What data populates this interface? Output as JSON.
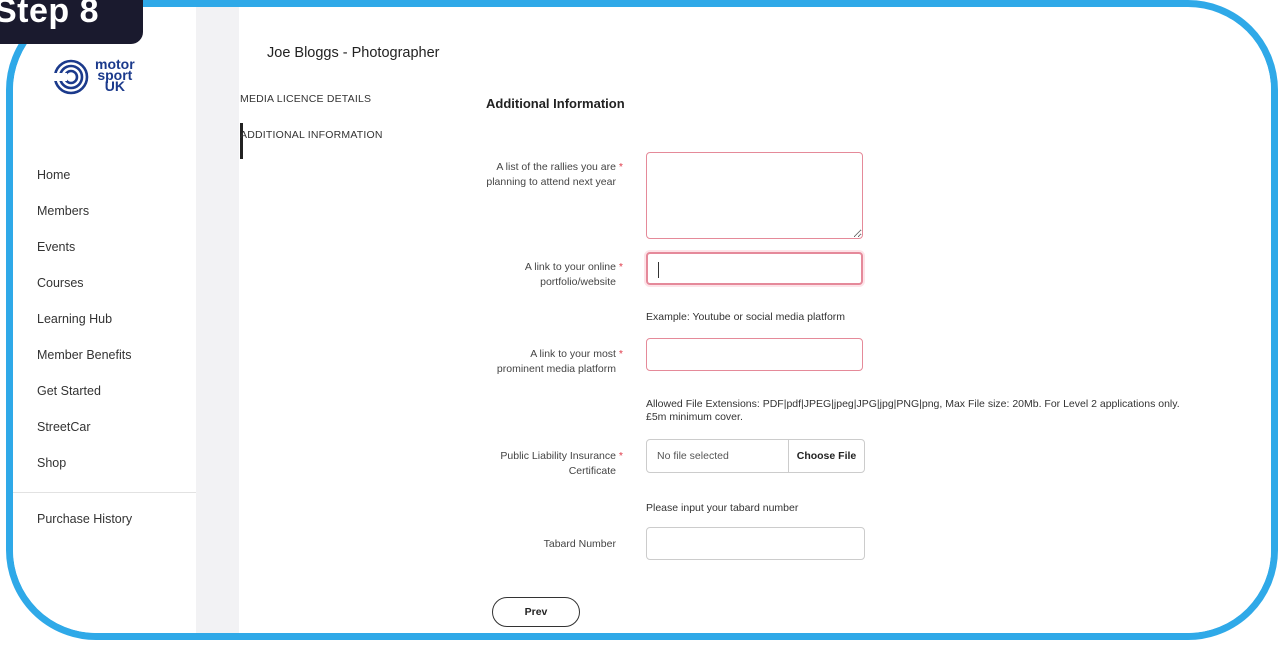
{
  "step_label": "Step 8",
  "brand": {
    "name_line1": "motor",
    "name_line2": "sport",
    "name_line3": "UK"
  },
  "nav": {
    "items": [
      "Home",
      "Members",
      "Events",
      "Courses",
      "Learning Hub",
      "Member Benefits",
      "Get Started",
      "StreetCar",
      "Shop"
    ],
    "purchase_history": "Purchase History"
  },
  "page": {
    "title": "Joe Bloggs - Photographer",
    "tabs": [
      "MEDIA LICENCE DETAILS",
      "ADDITIONAL INFORMATION"
    ],
    "active_tab": "ADDITIONAL INFORMATION",
    "section_title": "Additional Information"
  },
  "form": {
    "rallies_label_1": "A list of the rallies you are",
    "rallies_label_2": "planning to attend next year",
    "rallies_value": "",
    "portfolio_label_1": "A link to your online",
    "portfolio_label_2": "portfolio/website",
    "portfolio_value": "",
    "portfolio_help": "Example: Youtube or social media platform",
    "media_label_1": "A link to your most",
    "media_label_2": "prominent media platform",
    "media_value": "",
    "file_help": "Allowed File Extensions: PDF|pdf|JPEG|jpeg|JPG|jpg|PNG|png, Max File size: 20Mb. For Level 2 applications only. £5m minimum cover.",
    "insurance_label_1": "Public Liability Insurance",
    "insurance_label_2": "Certificate",
    "file_placeholder": "No file selected",
    "choose_file": "Choose File",
    "tabard_help": "Please input your tabard number",
    "tabard_label": "Tabard Number",
    "tabard_value": "",
    "required_mark": "*",
    "prev_button": "Prev"
  },
  "colors": {
    "frame": "#2fa9e8",
    "required": "#e03c4b",
    "brand": "#1b3a8c",
    "invalid_border": "#e58a99"
  }
}
